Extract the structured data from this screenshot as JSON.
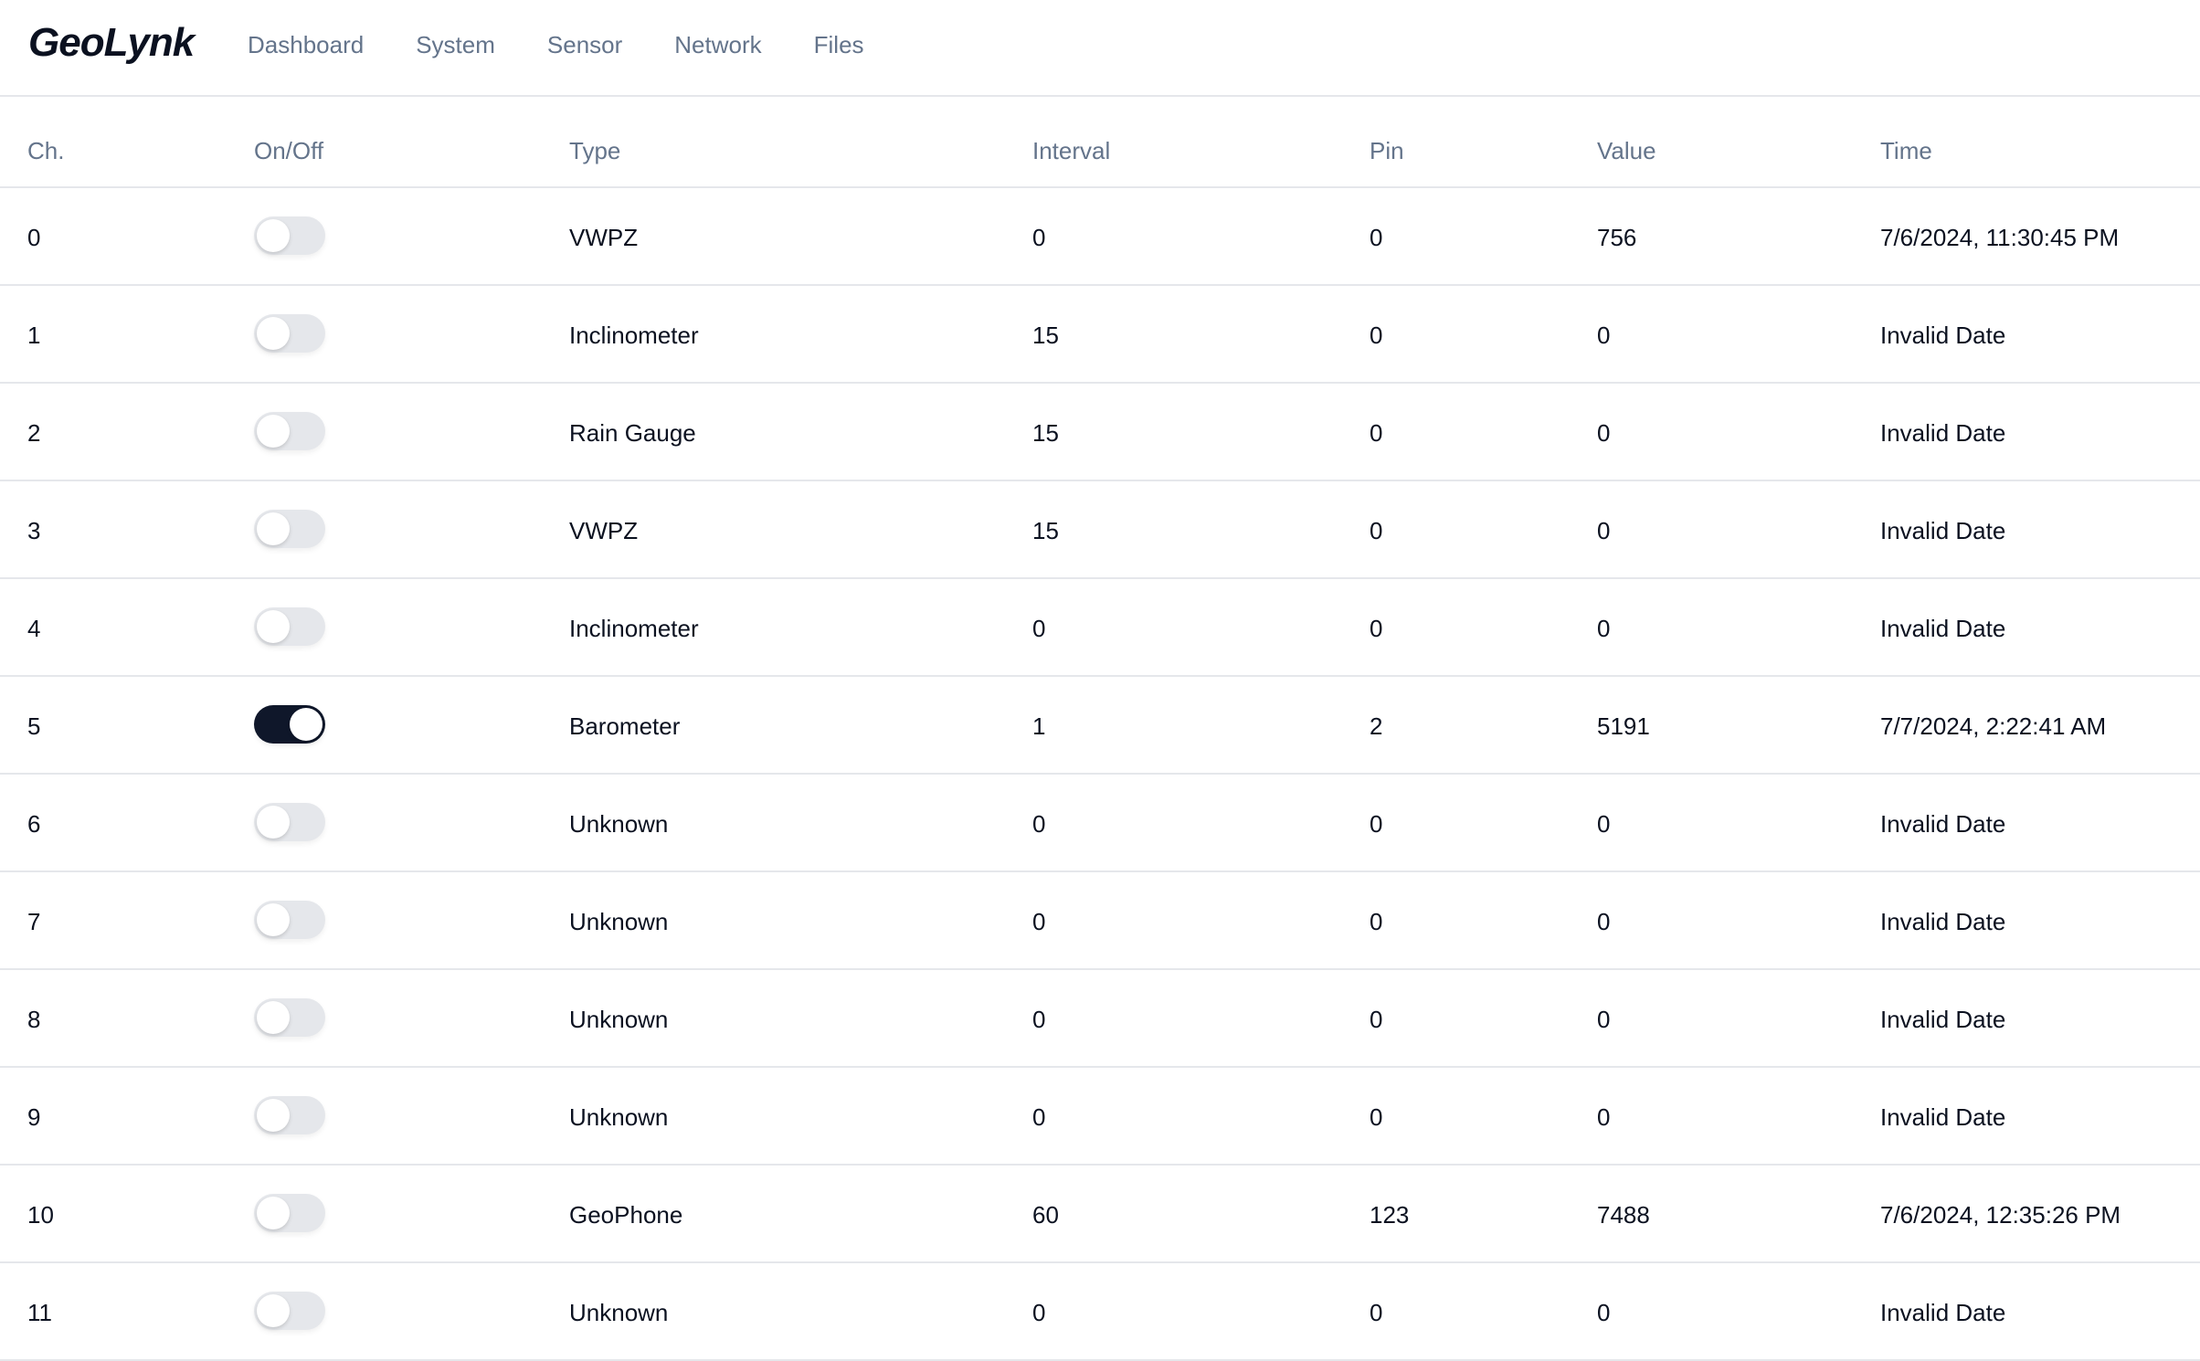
{
  "app": {
    "logo": "GeoLynk"
  },
  "nav": {
    "items": [
      {
        "label": "Dashboard"
      },
      {
        "label": "System"
      },
      {
        "label": "Sensor"
      },
      {
        "label": "Network"
      },
      {
        "label": "Files"
      }
    ]
  },
  "table": {
    "headers": {
      "ch": "Ch.",
      "onoff": "On/Off",
      "type": "Type",
      "interval": "Interval",
      "pin": "Pin",
      "value": "Value",
      "time": "Time"
    },
    "rows": [
      {
        "ch": "0",
        "on": false,
        "type": "VWPZ",
        "interval": "0",
        "pin": "0",
        "value": "756",
        "time": "7/6/2024, 11:30:45 PM"
      },
      {
        "ch": "1",
        "on": false,
        "type": "Inclinometer",
        "interval": "15",
        "pin": "0",
        "value": "0",
        "time": "Invalid Date"
      },
      {
        "ch": "2",
        "on": false,
        "type": "Rain Gauge",
        "interval": "15",
        "pin": "0",
        "value": "0",
        "time": "Invalid Date"
      },
      {
        "ch": "3",
        "on": false,
        "type": "VWPZ",
        "interval": "15",
        "pin": "0",
        "value": "0",
        "time": "Invalid Date"
      },
      {
        "ch": "4",
        "on": false,
        "type": "Inclinometer",
        "interval": "0",
        "pin": "0",
        "value": "0",
        "time": "Invalid Date"
      },
      {
        "ch": "5",
        "on": true,
        "type": "Barometer",
        "interval": "1",
        "pin": "2",
        "value": "5191",
        "time": "7/7/2024, 2:22:41 AM"
      },
      {
        "ch": "6",
        "on": false,
        "type": "Unknown",
        "interval": "0",
        "pin": "0",
        "value": "0",
        "time": "Invalid Date"
      },
      {
        "ch": "7",
        "on": false,
        "type": "Unknown",
        "interval": "0",
        "pin": "0",
        "value": "0",
        "time": "Invalid Date"
      },
      {
        "ch": "8",
        "on": false,
        "type": "Unknown",
        "interval": "0",
        "pin": "0",
        "value": "0",
        "time": "Invalid Date"
      },
      {
        "ch": "9",
        "on": false,
        "type": "Unknown",
        "interval": "0",
        "pin": "0",
        "value": "0",
        "time": "Invalid Date"
      },
      {
        "ch": "10",
        "on": false,
        "type": "GeoPhone",
        "interval": "60",
        "pin": "123",
        "value": "7488",
        "time": "7/6/2024, 12:35:26 PM"
      },
      {
        "ch": "11",
        "on": false,
        "type": "Unknown",
        "interval": "0",
        "pin": "0",
        "value": "0",
        "time": "Invalid Date"
      }
    ]
  },
  "colors": {
    "toggle_on": "#0f172a",
    "toggle_off": "#e5e7eb",
    "header_text": "#64748b",
    "body_text": "#0b1120"
  }
}
